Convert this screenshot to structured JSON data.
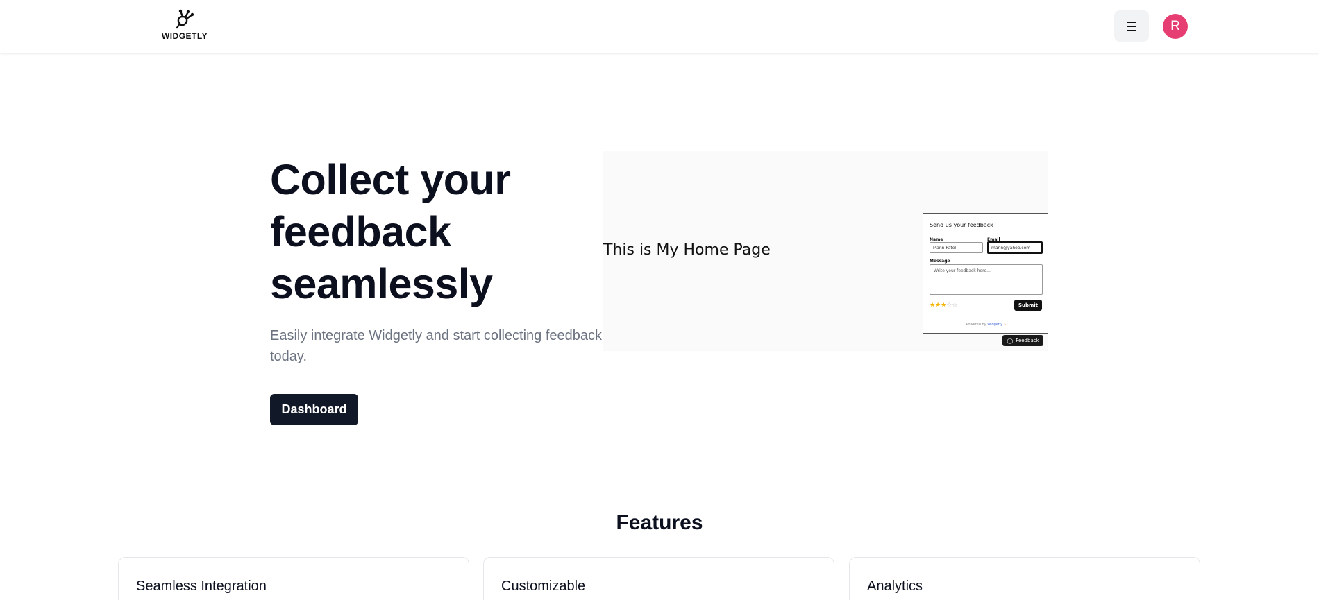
{
  "header": {
    "logo_text": "WIDGETLY",
    "avatar_letter": "R"
  },
  "hero": {
    "title_line1": "Collect your",
    "title_line2": "feedback",
    "title_line3": "seamlessly",
    "subtitle": "Easily integrate Widgetly and start collecting feedback today.",
    "dashboard_label": "Dashboard"
  },
  "preview": {
    "home_text": "This is My Home Page",
    "widget": {
      "title": "Send us your feedback",
      "name_label": "Name",
      "name_value": "Mann Patel",
      "email_label": "Email",
      "email_value": "mann@yahoo.com",
      "message_label": "Message",
      "message_placeholder": "Write your feedback here...",
      "rating": 3,
      "rating_max": 5,
      "submit_label": "Submit",
      "powered_prefix": "Powered by",
      "powered_brand": "Widgetly"
    },
    "feedback_button": "Feedback"
  },
  "features": {
    "title": "Features",
    "cards": [
      {
        "title": "Seamless Integration"
      },
      {
        "title": "Customizable"
      },
      {
        "title": "Analytics"
      }
    ]
  },
  "colors": {
    "primary_dark": "#111827",
    "avatar": "#e63e73",
    "star": "#f5b301",
    "muted_text": "#6b7280"
  },
  "icons": [
    "widgetly-logo-icon",
    "menu-icon",
    "star-icon",
    "chat-icon"
  ]
}
